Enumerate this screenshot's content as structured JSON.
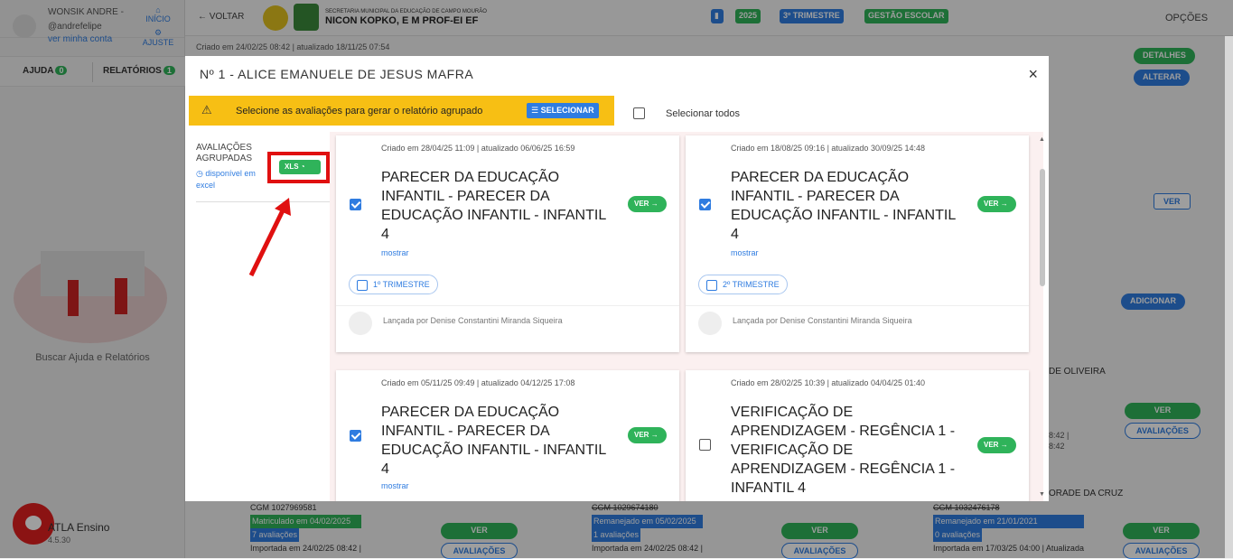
{
  "user": {
    "name": "WONSIK ANDRE -",
    "handle": "@andrefelipe",
    "profile_link": "ver minha conta",
    "home": "INÍCIO",
    "settings": "AJUSTE"
  },
  "left_tabs": {
    "help": "AJUDA",
    "help_count": "0",
    "reports": "RELATÓRIOS",
    "reports_count": "1"
  },
  "help_search": "Buscar Ajuda e Relatórios",
  "app": {
    "name": "ATLA Ensino",
    "version": "4.5.30"
  },
  "topbar": {
    "back": "VOLTAR",
    "secretaria": "SECRETARIA MUNICIPAL DA EDUCAÇÃO DE CAMPO MOURÃO",
    "school": "NICON KOPKO, E M PROF-EI EF",
    "year": "2025",
    "term": "3º TRIMESTRE",
    "gestao": "GESTÃO ESCOLAR",
    "options": "OPÇÕES"
  },
  "background": {
    "created": "Criado em 24/02/25 08:42 | atualizado 18/11/25 07:54",
    "details": "DETALHES",
    "alter": "ALTERAR",
    "ver": "VER",
    "add": "ADICIONAR",
    "name_frag1": "DE OLIVEIRA",
    "name_frag2": "ORADE DA CRUZ",
    "ts1": "8:42 |",
    "ts2": "8:42",
    "btn_ver": "VER",
    "btn_aval": "AVALIAÇÕES",
    "students": [
      {
        "cgm": "CGM 1027969581",
        "status": "Matriculado em 04/02/2025",
        "evals": "7 avaliações",
        "imported": "Importada em 24/02/25 08:42 |"
      },
      {
        "cgm": "CGM 1029674180",
        "status": "Remanejado em 05/02/2025",
        "evals": "1 avaliações",
        "imported": "Importada em 24/02/25 08:42 |"
      },
      {
        "cgm": "CGM 1032476178",
        "status": "Remanejado em 21/01/2021",
        "evals": "0 avaliações",
        "imported": "Importada em 17/03/25 04:00 | Atualizada"
      }
    ]
  },
  "modal": {
    "title": "Nº 1 - ALICE EMANUELE DE JESUS MAFRA",
    "close": "×",
    "warning": "Selecione as avaliações para gerar o relatório agrupado",
    "select_btn": "SELECIONAR",
    "select_all": "Selecionar todos",
    "side_title": "AVALIAÇÕES AGRUPADAS",
    "side_sub": "disponível em excel",
    "xls": "XLS",
    "cards": [
      {
        "meta": "Criado em 28/04/25 11:09 | atualizado 06/06/25 16:59",
        "title": "PARECER DA EDUCAÇÃO INFANTIL - PARECER DA EDUCAÇÃO INFANTIL - INFANTIL 4",
        "more": "mostrar",
        "ver": "VER",
        "term": "1º TRIMESTRE",
        "author": "Lançada por Denise Constantini Miranda Siqueira",
        "checked": true
      },
      {
        "meta": "Criado em 18/08/25 09:16 | atualizado 30/09/25 14:48",
        "title": "PARECER DA EDUCAÇÃO INFANTIL - PARECER DA EDUCAÇÃO INFANTIL - INFANTIL 4",
        "more": "mostrar",
        "ver": "VER",
        "term": "2º TRIMESTRE",
        "author": "Lançada por Denise Constantini Miranda Siqueira",
        "checked": true
      },
      {
        "meta": "Criado em 05/11/25 09:49 | atualizado 04/12/25 17:08",
        "title": "PARECER DA EDUCAÇÃO INFANTIL - PARECER DA EDUCAÇÃO INFANTIL - INFANTIL 4",
        "more": "mostrar",
        "ver": "VER",
        "checked": true
      },
      {
        "meta": "Criado em 28/02/25 10:39 | atualizado 04/04/25 01:40",
        "title": "VERIFICAÇÃO DE APRENDIZAGEM - REGÊNCIA 1 - VERIFICAÇÃO DE APRENDIZAGEM - REGÊNCIA 1 - INFANTIL 4",
        "ver": "VER",
        "checked": false
      }
    ]
  },
  "colors": {
    "green": "#2fb35a",
    "blue": "#2f7ce0",
    "yellow": "#f7bf14",
    "red": "#e01010"
  }
}
